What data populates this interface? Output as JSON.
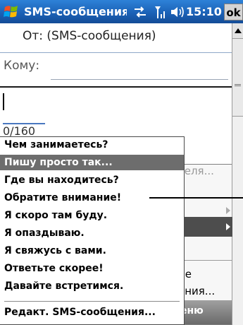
{
  "titlebar": {
    "title": "SMS-сообщения",
    "time": "15:10",
    "ok_label": "ok"
  },
  "header": {
    "from_label": "От: (SMS-сообщения)",
    "to_label": "Кому:",
    "to_value": ""
  },
  "body": {
    "counter": "0/160"
  },
  "background_menu": {
    "items": [
      "теля...",
      "ие",
      "ения...",
      "еню"
    ]
  },
  "quick_text_menu": {
    "items": [
      "Чем занимаетесь?",
      "Пишу просто так...",
      "Где вы находитесь?",
      "Обратите внимание!",
      "Я скоро там буду.",
      "Я опаздываю.",
      "Я свяжусь с вами.",
      "Ответьте скорее!",
      "Давайте встретимся."
    ],
    "selected_index": 1,
    "edit_item": "Редакт. SMS-сообщения..."
  },
  "icons": [
    "start-flag-icon",
    "sync-icon",
    "signal-icon",
    "volume-icon"
  ],
  "colors": {
    "titlebar": "#1a5fb4",
    "menu_selection": "#6d6d6d",
    "submenu_selection": "#4d4d4d"
  }
}
